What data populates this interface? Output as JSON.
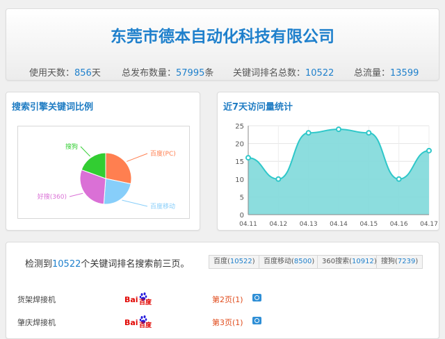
{
  "header": {
    "company": "东莞市德本自动化科技有限公司",
    "stats": [
      {
        "label": "使用天数：",
        "value": "856",
        "suffix": "天"
      },
      {
        "label": "总发布数量：",
        "value": "57995",
        "suffix": "条"
      },
      {
        "label": "关键词排名总数：",
        "value": "10522",
        "suffix": ""
      },
      {
        "label": "总流量：",
        "value": "13599",
        "suffix": ""
      }
    ]
  },
  "pie_panel": {
    "title": "搜索引擎关键词比例"
  },
  "line_panel": {
    "title": "近7天访问量统计"
  },
  "chart_data": [
    {
      "type": "pie",
      "categories": [
        "百度(PC)",
        "百度移动",
        "好搜(360)",
        "搜狗"
      ],
      "values": [
        10522,
        8500,
        10912,
        7239
      ],
      "colors": [
        "#ff7f50",
        "#87cefa",
        "#da70d6",
        "#32cd32"
      ],
      "title": ""
    },
    {
      "type": "area",
      "x": [
        "04.11",
        "04.12",
        "04.13",
        "04.14",
        "04.15",
        "04.16",
        "04.17"
      ],
      "values": [
        16,
        10,
        23,
        24,
        23,
        10,
        18
      ],
      "ylim": [
        0,
        25
      ],
      "yticks": [
        0,
        5,
        10,
        15,
        20,
        25
      ],
      "grid": true,
      "line_color": "#2ec7c9",
      "fill_color": "#7fd9da",
      "title": ""
    }
  ],
  "bottom": {
    "detect_prefix": "检测到",
    "detect_count": "10522",
    "detect_suffix": "个关键词排名搜索前三页。",
    "engines": [
      {
        "name": "百度",
        "count": "10522"
      },
      {
        "name": "百度移动",
        "count": "8500"
      },
      {
        "name": "360搜索",
        "count": "10912"
      },
      {
        "name": "搜狗",
        "count": "7239"
      }
    ],
    "rows": [
      {
        "keyword": "货架焊接机",
        "engine_logo": "Bai百度",
        "rank": "第2页(1)"
      },
      {
        "keyword": "肇庆焊接机",
        "engine_logo": "Bai百度",
        "rank": "第3页(1)"
      }
    ]
  }
}
